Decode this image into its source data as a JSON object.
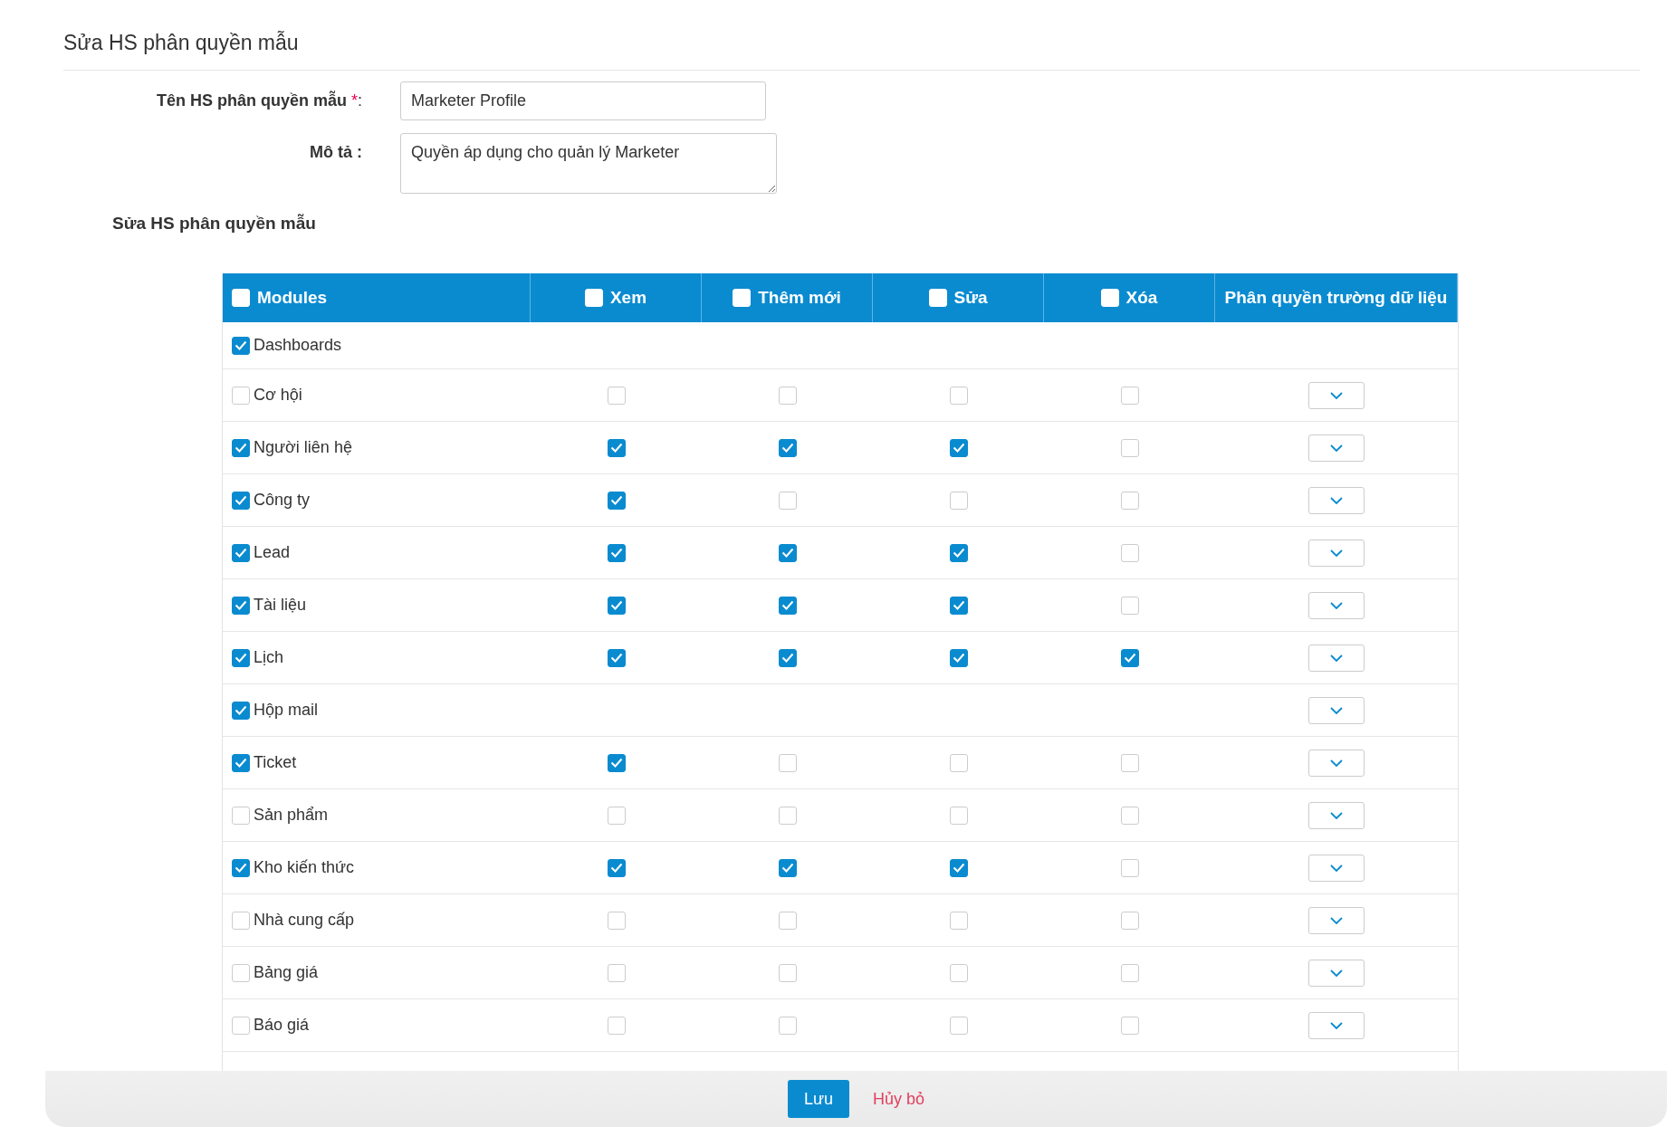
{
  "page_title": "Sửa HS phân quyền mẫu",
  "form": {
    "name_label": "Tên HS phân quyền mẫu",
    "required_mark": "*",
    "name_colon": ":",
    "name_value": "Marketer Profile",
    "description_label": "Mô tả :",
    "description_value": "Quyền áp dụng cho quản lý Marketer"
  },
  "section_title": "Sửa HS phân quyền mẫu",
  "table": {
    "columns": [
      {
        "label": "Modules",
        "checked": false
      },
      {
        "label": "Xem",
        "checked": false
      },
      {
        "label": "Thêm mới",
        "checked": false
      },
      {
        "label": "Sửa",
        "checked": false
      },
      {
        "label": "Xóa",
        "checked": false
      },
      {
        "label": "Phân quyền trường dữ liệu"
      }
    ],
    "rows": [
      {
        "name": "Dashboards",
        "checked": true,
        "field_menu": false
      },
      {
        "name": "Cơ hội",
        "checked": false,
        "permissions": [
          false,
          false,
          false,
          false
        ],
        "field_menu": true
      },
      {
        "name": "Người liên hệ",
        "checked": true,
        "permissions": [
          true,
          true,
          true,
          false
        ],
        "field_menu": true
      },
      {
        "name": "Công ty",
        "checked": true,
        "permissions": [
          true,
          false,
          false,
          false
        ],
        "field_menu": true
      },
      {
        "name": "Lead",
        "checked": true,
        "permissions": [
          true,
          true,
          true,
          false
        ],
        "field_menu": true
      },
      {
        "name": "Tài liệu",
        "checked": true,
        "permissions": [
          true,
          true,
          true,
          false
        ],
        "field_menu": true
      },
      {
        "name": "Lịch",
        "checked": true,
        "permissions": [
          true,
          true,
          true,
          true
        ],
        "field_menu": true
      },
      {
        "name": "Hộp mail",
        "checked": true,
        "field_menu": true
      },
      {
        "name": "Ticket",
        "checked": true,
        "permissions": [
          true,
          false,
          false,
          false
        ],
        "field_menu": true
      },
      {
        "name": "Sản phẩm",
        "checked": false,
        "permissions": [
          false,
          false,
          false,
          false
        ],
        "field_menu": true
      },
      {
        "name": "Kho kiến thức",
        "checked": true,
        "permissions": [
          true,
          true,
          true,
          false
        ],
        "field_menu": true
      },
      {
        "name": "Nhà cung cấp",
        "checked": false,
        "permissions": [
          false,
          false,
          false,
          false
        ],
        "field_menu": true
      },
      {
        "name": "Bảng giá",
        "checked": false,
        "permissions": [
          false,
          false,
          false,
          false
        ],
        "field_menu": true
      },
      {
        "name": "Báo giá",
        "checked": false,
        "permissions": [
          false,
          false,
          false,
          false
        ],
        "field_menu": true
      }
    ]
  },
  "footer": {
    "save": "Lưu",
    "cancel": "Hủy bỏ"
  }
}
